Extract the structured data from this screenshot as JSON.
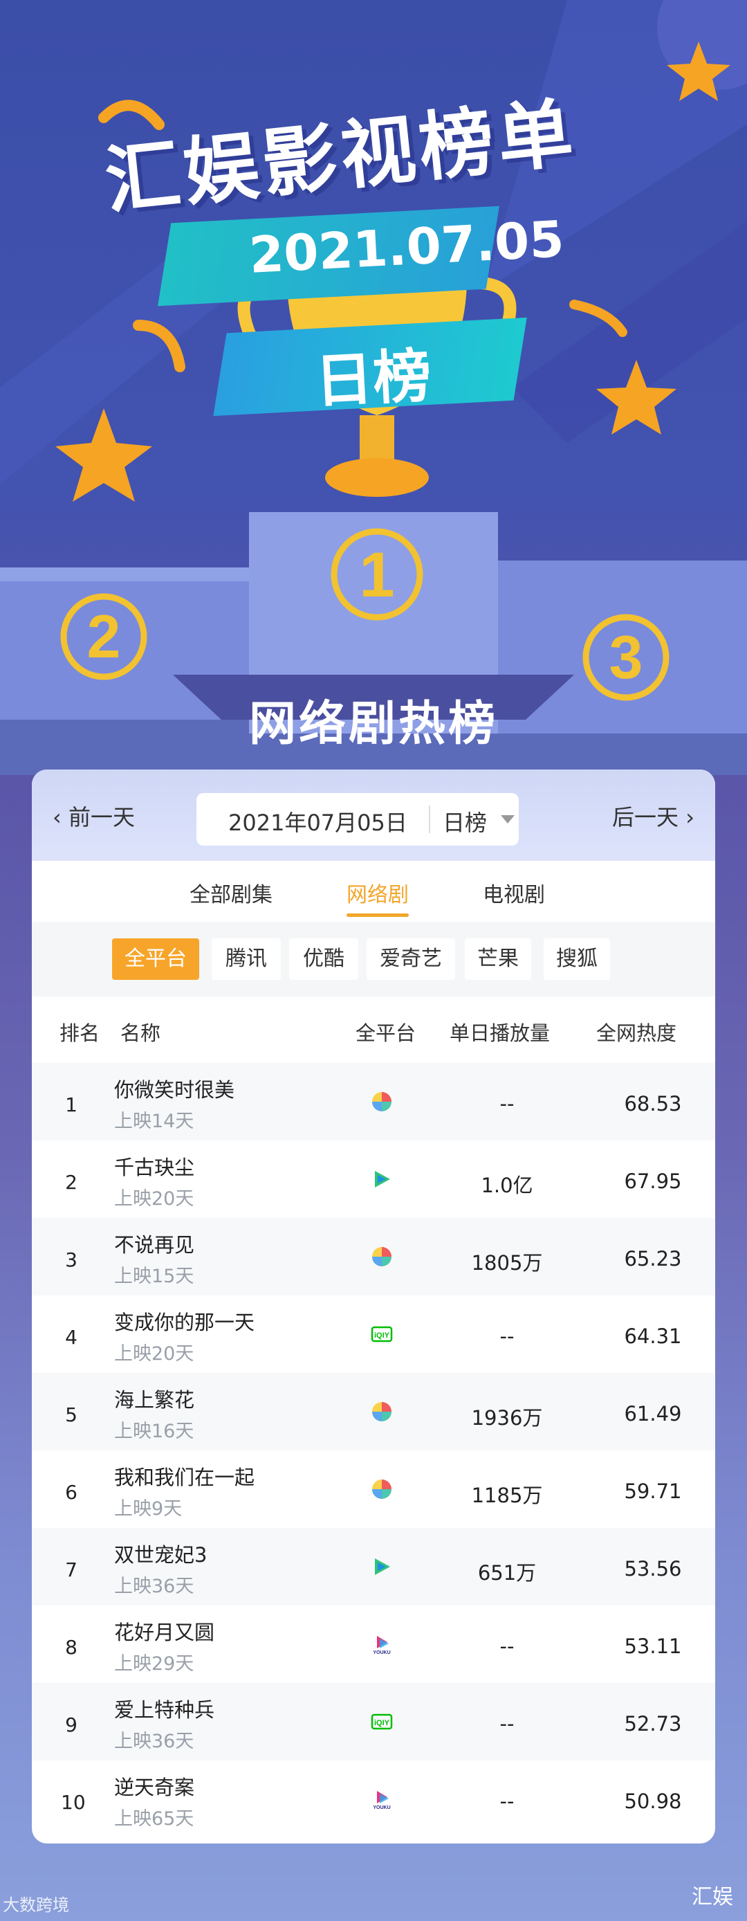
{
  "banner": {
    "title": "汇娱影视榜单",
    "date": "2021.07.05",
    "rank_type": "日榜",
    "podium": [
      "1",
      "2",
      "3"
    ],
    "section_title": "网络剧热榜"
  },
  "colors": {
    "accent": "#f3a62b",
    "header_bg": "#cfd7f6",
    "teal": "#21c0c6",
    "gold": "#f2c230"
  },
  "nav": {
    "prev_label": "前一天",
    "next_label": "后一天",
    "date_value": "2021年07月05日",
    "period_value": "日榜"
  },
  "tabs": [
    {
      "label": "全部剧集",
      "active": false
    },
    {
      "label": "网络剧",
      "active": true
    },
    {
      "label": "电视剧",
      "active": false
    }
  ],
  "platforms": [
    {
      "label": "全平台",
      "active": true
    },
    {
      "label": "腾讯",
      "active": false
    },
    {
      "label": "优酷",
      "active": false
    },
    {
      "label": "爱奇艺",
      "active": false
    },
    {
      "label": "芒果",
      "active": false
    },
    {
      "label": "搜狐",
      "active": false
    }
  ],
  "table": {
    "headers": [
      "排名",
      "名称",
      "全平台",
      "单日播放量",
      "全网热度"
    ],
    "rows": [
      {
        "rank": "1",
        "name": "你微笑时很美",
        "days": "上映14天",
        "platform": "multi-platform-icon",
        "views": "--",
        "heat": "68.53"
      },
      {
        "rank": "2",
        "name": "千古玦尘",
        "days": "上映20天",
        "platform": "tencent-video-icon",
        "views": "1.0亿",
        "heat": "67.95"
      },
      {
        "rank": "3",
        "name": "不说再见",
        "days": "上映15天",
        "platform": "multi-platform-icon",
        "views": "1805万",
        "heat": "65.23"
      },
      {
        "rank": "4",
        "name": "变成你的那一天",
        "days": "上映20天",
        "platform": "iqiyi-icon",
        "views": "--",
        "heat": "64.31"
      },
      {
        "rank": "5",
        "name": "海上繁花",
        "days": "上映16天",
        "platform": "multi-platform-icon",
        "views": "1936万",
        "heat": "61.49"
      },
      {
        "rank": "6",
        "name": "我和我们在一起",
        "days": "上映9天",
        "platform": "multi-platform-icon",
        "views": "1185万",
        "heat": "59.71"
      },
      {
        "rank": "7",
        "name": "双世宠妃3",
        "days": "上映36天",
        "platform": "tencent-video-icon",
        "views": "651万",
        "heat": "53.56"
      },
      {
        "rank": "8",
        "name": "花好月又圆",
        "days": "上映29天",
        "platform": "youku-icon",
        "views": "--",
        "heat": "53.11"
      },
      {
        "rank": "9",
        "name": "爱上特种兵",
        "days": "上映36天",
        "platform": "iqiyi-icon",
        "views": "--",
        "heat": "52.73"
      },
      {
        "rank": "10",
        "name": "逆天奇案",
        "days": "上映65天",
        "platform": "youku-icon",
        "views": "--",
        "heat": "50.98"
      }
    ]
  },
  "footer": {
    "left_watermark": "大数跨境",
    "right_watermark": "汇娱"
  }
}
